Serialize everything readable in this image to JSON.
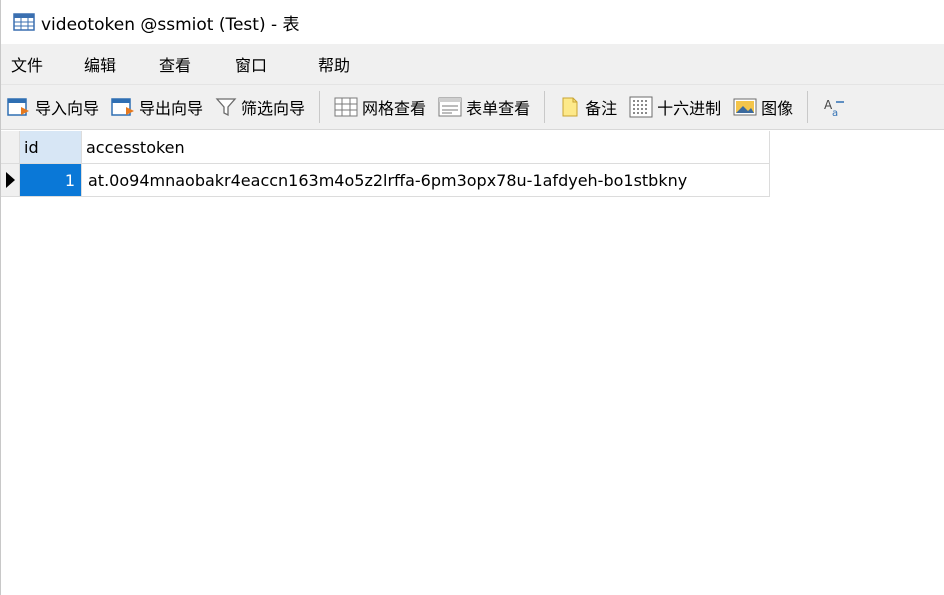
{
  "window": {
    "title": "videotoken @ssmiot (Test) - 表"
  },
  "menu": {
    "items": [
      "文件",
      "编辑",
      "查看",
      "窗口",
      "帮助"
    ]
  },
  "toolbar": {
    "import_wizard": "导入向导",
    "export_wizard": "导出向导",
    "filter_wizard": "筛选向导",
    "grid_view": "网格查看",
    "form_view": "表单查看",
    "memo": "备注",
    "hex": "十六进制",
    "image": "图像"
  },
  "table": {
    "columns": [
      "id",
      "accesstoken"
    ],
    "rows": [
      {
        "id": "1",
        "accesstoken": "at.0o94mnaobakr4eaccn163m4o5z2lrffa-6pm3opx78u-1afdyeh-bo1stbkny"
      }
    ]
  }
}
